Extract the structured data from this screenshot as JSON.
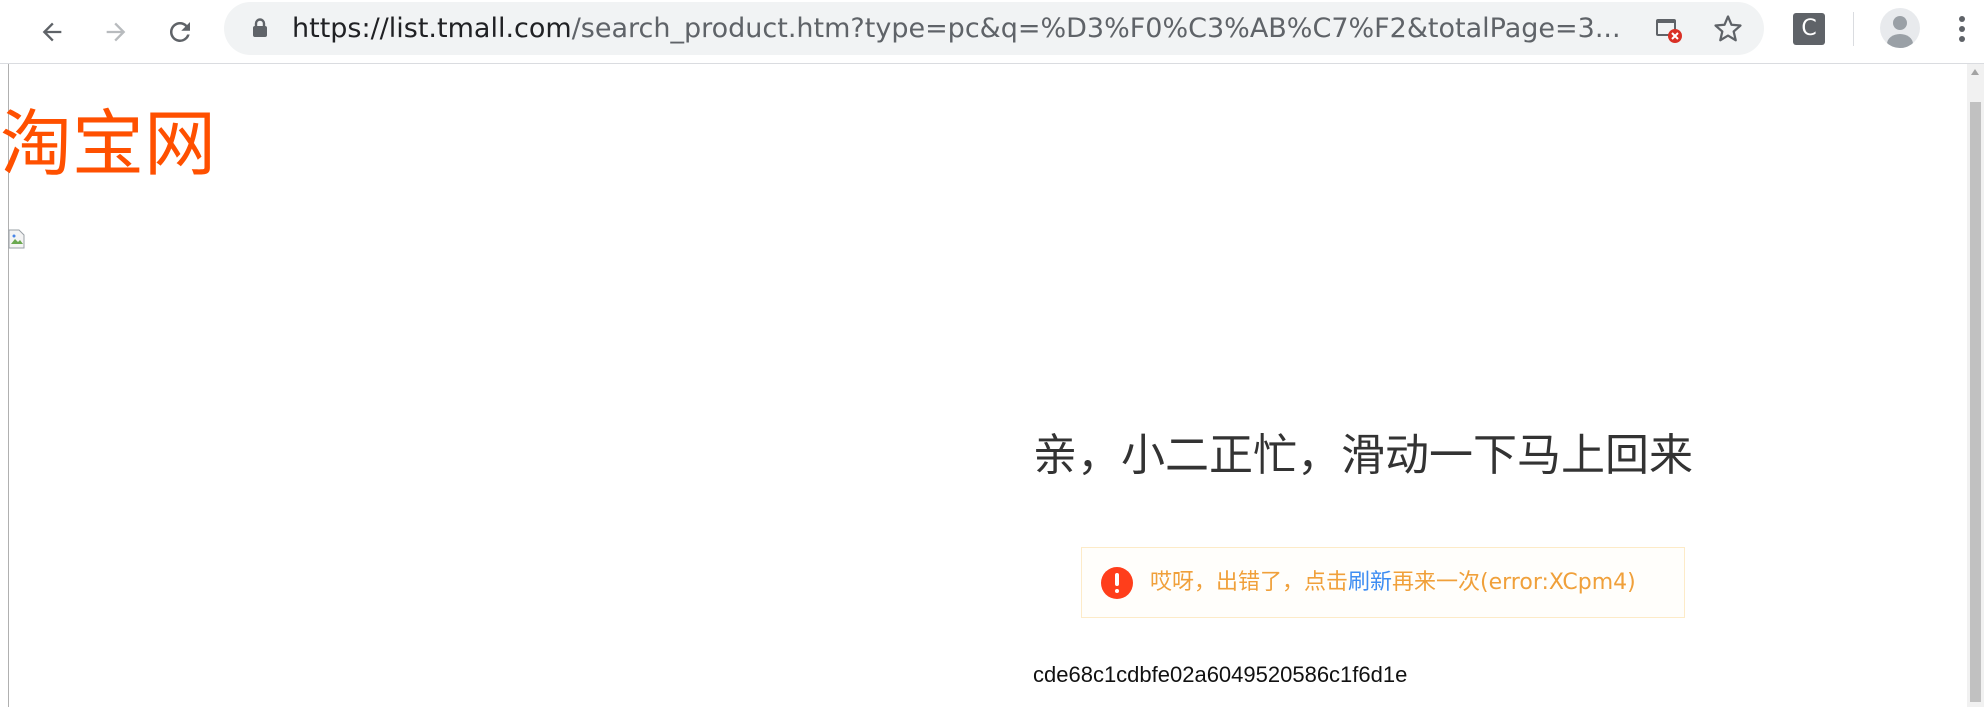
{
  "browser": {
    "url_host": "https://list.tmall.com",
    "url_rest": "/search_product.htm?type=pc&q=%D3%F0%C3%AB%C7%F2&totalPage=3...",
    "extension_label": "C",
    "icons": {
      "back": "back-arrow-icon",
      "forward": "forward-arrow-icon",
      "reload": "reload-icon",
      "lock": "lock-icon",
      "popup_blocked": "popup-blocked-icon",
      "bookmark": "star-icon",
      "profile": "avatar-icon",
      "menu": "kebab-menu-icon"
    },
    "colors": {
      "omnibox_bg": "#f1f3f4",
      "icon": "#5f6368"
    }
  },
  "page": {
    "logo_text": "淘宝网",
    "heading": "亲，小二正忙，滑动一下马上回来",
    "error": {
      "prefix": "哎呀，出错了，点击",
      "link": "刷新",
      "suffix": "再来一次(error:XCpm4)"
    },
    "token": "cde68c1cdbfe02a6049520586c1f6d1e",
    "colors": {
      "logo": "#ff5000",
      "error_text": "#f0a03a",
      "link": "#3e8df2",
      "error_icon": "#ff3e1b"
    }
  }
}
